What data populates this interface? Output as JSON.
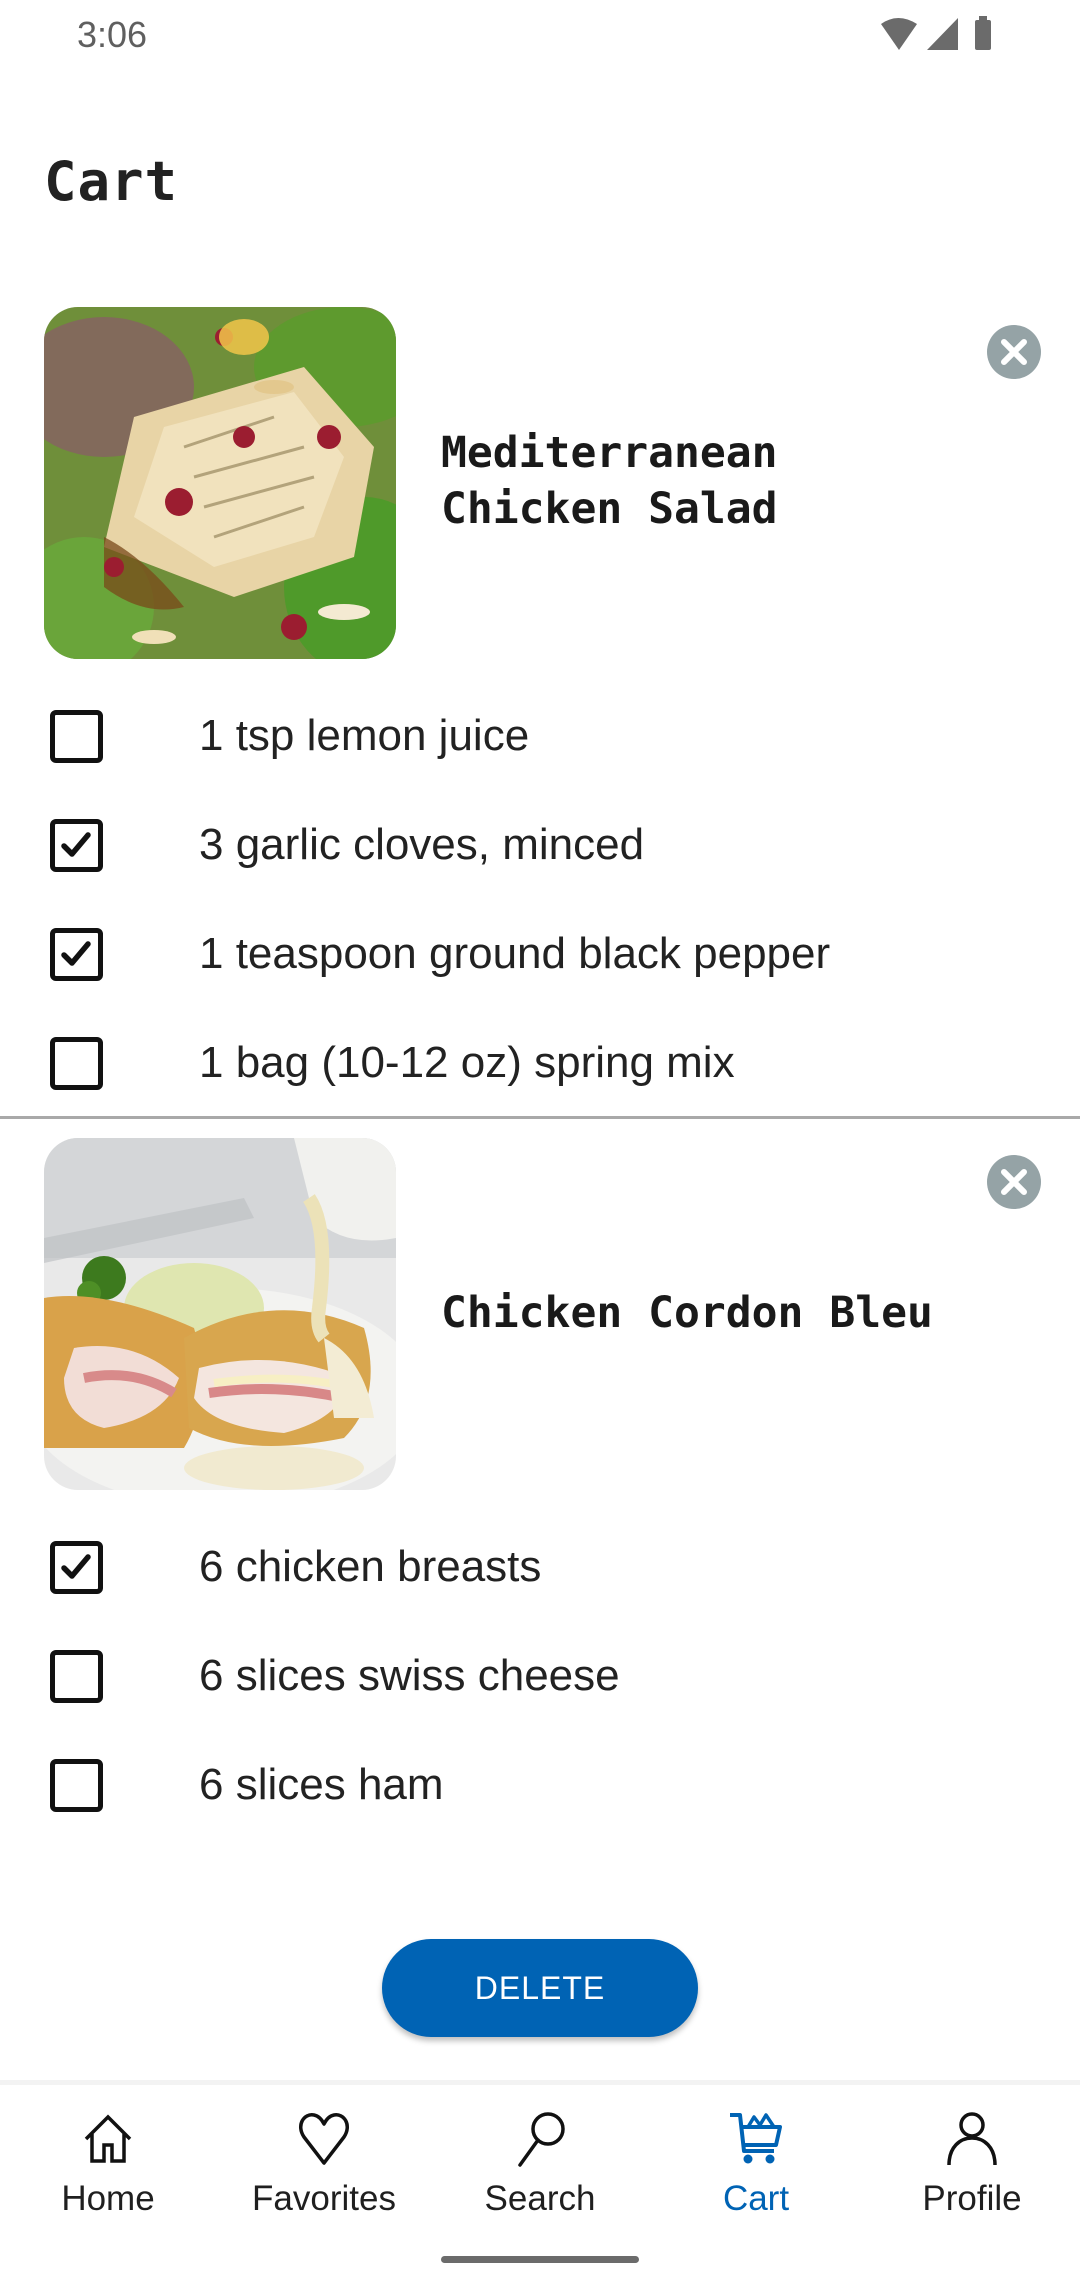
{
  "status_bar": {
    "time": "3:06",
    "icons": [
      "wifi-icon",
      "cellular-signal-icon",
      "battery-icon"
    ]
  },
  "page": {
    "title": "Cart"
  },
  "recipes": [
    {
      "name": "Mediterranean\nChicken Salad",
      "image": "chicken-salad-photo",
      "remove_icon": "close-circle-icon",
      "ingredients": [
        {
          "label": "1 tsp lemon juice",
          "checked": false
        },
        {
          "label": "3 garlic cloves, minced",
          "checked": true
        },
        {
          "label": "1 teaspoon ground black pepper",
          "checked": true
        },
        {
          "label": "1 bag (10-12 oz) spring mix",
          "checked": false
        }
      ]
    },
    {
      "name": "Chicken Cordon Bleu",
      "image": "chicken-cordon-bleu-photo",
      "remove_icon": "close-circle-icon",
      "ingredients": [
        {
          "label": "6 chicken breasts",
          "checked": true
        },
        {
          "label": "6 slices swiss cheese",
          "checked": false
        },
        {
          "label": "6 slices ham",
          "checked": false
        }
      ]
    }
  ],
  "actions": {
    "delete_label": "DELETE"
  },
  "bottom_nav": {
    "active": "Cart",
    "items": [
      {
        "label": "Home",
        "icon": "home-icon"
      },
      {
        "label": "Favorites",
        "icon": "heart-icon"
      },
      {
        "label": "Search",
        "icon": "search-icon"
      },
      {
        "label": "Cart",
        "icon": "cart-icon"
      },
      {
        "label": "Profile",
        "icon": "profile-icon"
      }
    ]
  },
  "colors": {
    "accent": "#0063b4",
    "remove_button": "#95a3a6",
    "divider": "#a9a9a9"
  }
}
